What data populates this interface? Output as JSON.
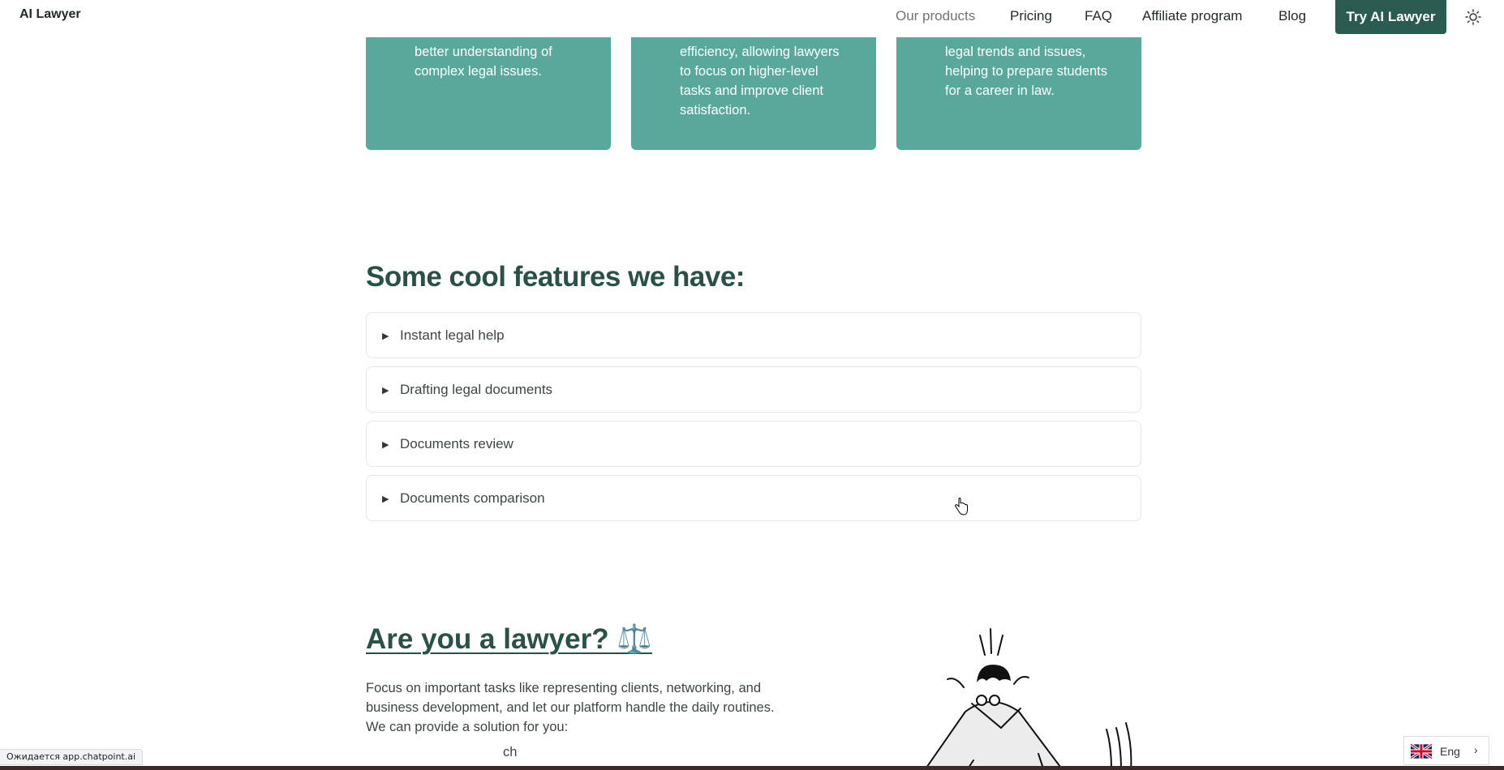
{
  "header": {
    "logo": "AI Lawyer",
    "nav": [
      {
        "label": "Our products",
        "muted": true
      },
      {
        "label": "Pricing",
        "muted": false
      },
      {
        "label": "FAQ",
        "muted": false
      },
      {
        "label": "Affiliate program",
        "muted": false
      },
      {
        "label": "Blog",
        "muted": false
      }
    ],
    "cta": "Try AI Lawyer",
    "theme_icon": "sun-icon"
  },
  "cards": [
    {
      "text": "better understanding of\ncomplex legal issues."
    },
    {
      "text": "efficiency, allowing lawyers\nto focus on higher-level\ntasks and improve client\nsatisfaction."
    },
    {
      "text": "legal trends and issues,\nhelping to prepare students\nfor a career in law."
    }
  ],
  "features": {
    "title": "Some cool features we have:",
    "items": [
      {
        "label": "Instant legal help"
      },
      {
        "label": "Drafting legal documents"
      },
      {
        "label": "Documents review"
      },
      {
        "label": "Documents comparison"
      }
    ]
  },
  "lawyer": {
    "title": "Are you a lawyer? ⚖️",
    "body": "Focus on important tasks like representing clients, networking, and business development, and let our platform handle the daily routines. We can provide a solution for you:",
    "partial_line": "ch"
  },
  "status_bar": "Ожидается app.chatpoint.ai",
  "language": {
    "label": "Eng",
    "flag_icon": "uk-flag-icon"
  },
  "colors": {
    "accent": "#2a5b51",
    "card": "#58a89c"
  }
}
